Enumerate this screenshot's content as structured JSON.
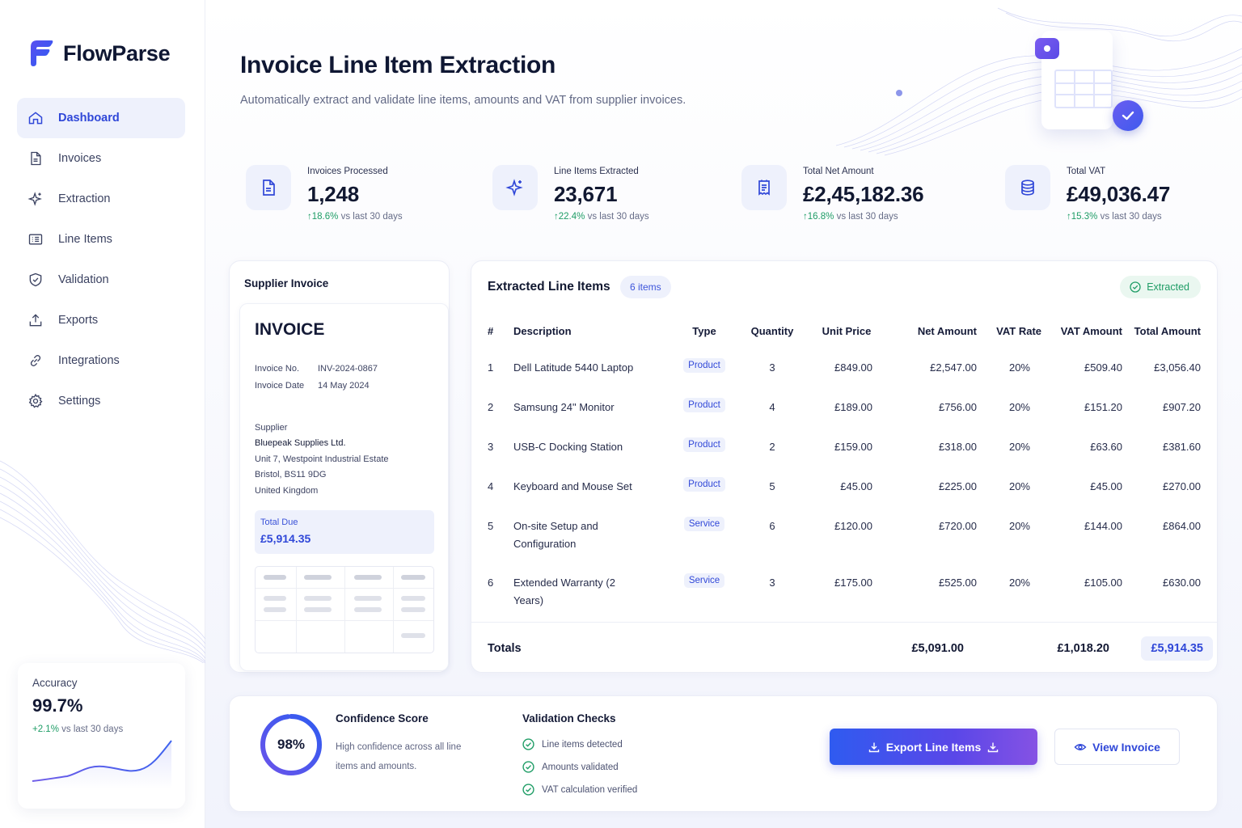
{
  "brand": {
    "name": "FlowParse"
  },
  "colors": {
    "accent": "#2f47d8",
    "positive": "#1f9d66",
    "soft_accent_bg": "#eef1fc"
  },
  "sidebar": {
    "items": [
      {
        "label": "Dashboard",
        "icon": "home-icon",
        "active": true
      },
      {
        "label": "Invoices",
        "icon": "document-icon"
      },
      {
        "label": "Extraction",
        "icon": "sparkle-icon"
      },
      {
        "label": "Line Items",
        "icon": "list-icon"
      },
      {
        "label": "Validation",
        "icon": "shield-check-icon"
      },
      {
        "label": "Exports",
        "icon": "upload-icon"
      },
      {
        "label": "Integrations",
        "icon": "link-icon"
      },
      {
        "label": "Settings",
        "icon": "gear-icon"
      }
    ],
    "accuracy": {
      "label": "Accuracy",
      "value": "99.7%",
      "delta": "+2.1%",
      "delta_suffix": "vs last 30 days"
    }
  },
  "header": {
    "title": "Invoice Line Item Extraction",
    "subtitle": "Automatically extract and validate line items, amounts and VAT from supplier invoices."
  },
  "stats": [
    {
      "label": "Invoices Processed",
      "value": "1,248",
      "delta": "18.6%",
      "suffix": "vs last 30 days",
      "icon": "document-icon"
    },
    {
      "label": "Line Items Extracted",
      "value": "23,671",
      "delta": "22.4%",
      "suffix": "vs last 30 days",
      "icon": "sparkle-icon"
    },
    {
      "label": "Total Net Amount",
      "value": "£2,45,182.36",
      "delta": "16.8%",
      "suffix": "vs last 30 days",
      "icon": "receipt-icon"
    },
    {
      "label": "Total VAT",
      "value": "£49,036.47",
      "delta": "15.3%",
      "suffix": "vs last 30 days",
      "icon": "database-icon"
    }
  ],
  "supplier_invoice": {
    "panel_title": "Supplier Invoice",
    "heading": "INVOICE",
    "invoice_no_label": "Invoice No.",
    "invoice_no": "INV-2024-0867",
    "invoice_date_label": "Invoice Date",
    "invoice_date": "14 May 2024",
    "supplier_label": "Supplier",
    "supplier_name": "Bluepeak Supplies Ltd.",
    "address1": "Unit 7, Westpoint Industrial Estate",
    "address2": "Bristol, BS11 9DG",
    "address3": "United Kingdom",
    "total_due_label": "Total Due",
    "total_due": "£5,914.35"
  },
  "line_items": {
    "title": "Extracted Line Items",
    "count_badge": "6 items",
    "status": "Extracted",
    "columns": [
      "#",
      "Description",
      "Type",
      "Quantity",
      "Unit Price",
      "Net Amount",
      "VAT Rate",
      "VAT Amount",
      "Total Amount"
    ],
    "rows": [
      {
        "n": "1",
        "desc": "Dell Latitude 5440 Laptop",
        "type": "Product",
        "qty": "3",
        "unit": "£849.00",
        "net": "£2,547.00",
        "rate": "20%",
        "vat": "£509.40",
        "total": "£3,056.40"
      },
      {
        "n": "2",
        "desc": "Samsung 24\" Monitor",
        "type": "Product",
        "qty": "4",
        "unit": "£189.00",
        "net": "£756.00",
        "rate": "20%",
        "vat": "£151.20",
        "total": "£907.20"
      },
      {
        "n": "3",
        "desc": "USB-C Docking Station",
        "type": "Product",
        "qty": "2",
        "unit": "£159.00",
        "net": "£318.00",
        "rate": "20%",
        "vat": "£63.60",
        "total": "£381.60"
      },
      {
        "n": "4",
        "desc": "Keyboard and Mouse Set",
        "type": "Product",
        "qty": "5",
        "unit": "£45.00",
        "net": "£225.00",
        "rate": "20%",
        "vat": "£45.00",
        "total": "£270.00"
      },
      {
        "n": "5",
        "desc": "On-site Setup and Configuration",
        "type": "Service",
        "qty": "6",
        "unit": "£120.00",
        "net": "£720.00",
        "rate": "20%",
        "vat": "£144.00",
        "total": "£864.00"
      },
      {
        "n": "6",
        "desc": "Extended Warranty (2 Years)",
        "type": "Service",
        "qty": "3",
        "unit": "£175.00",
        "net": "£525.00",
        "rate": "20%",
        "vat": "£105.00",
        "total": "£630.00"
      }
    ],
    "totals": {
      "label": "Totals",
      "net": "£5,091.00",
      "vat": "£1,018.20",
      "total": "£5,914.35"
    }
  },
  "confidence": {
    "value": "98%",
    "percent": 98,
    "title": "Confidence Score",
    "desc": "High confidence across all line items and amounts."
  },
  "validation": {
    "title": "Validation Checks",
    "checks": [
      "Line items detected",
      "Amounts validated",
      "VAT calculation verified"
    ]
  },
  "actions": {
    "export": "Export Line Items",
    "view": "View Invoice"
  }
}
